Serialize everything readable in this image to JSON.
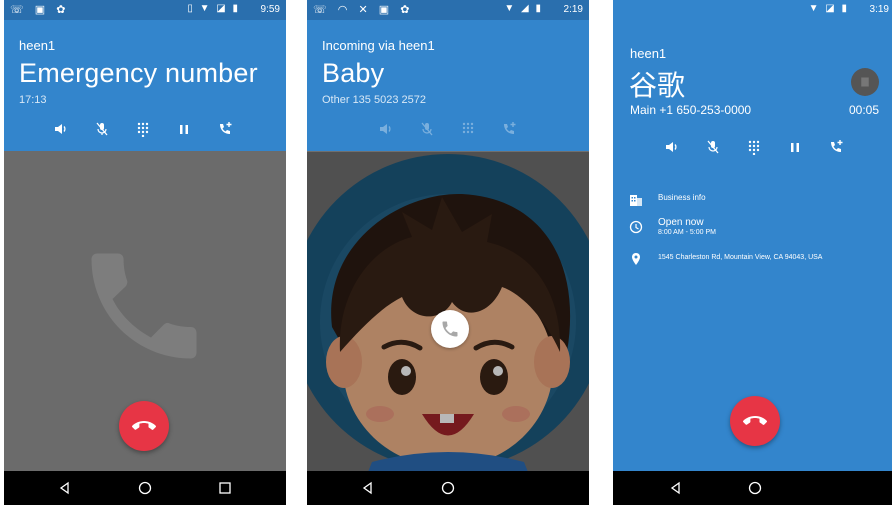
{
  "screen1": {
    "status_time": "9:59",
    "account": "heen1",
    "name": "Emergency number",
    "subtitle": "17:13",
    "controls": [
      "speaker-icon",
      "mute-icon",
      "dialpad-icon",
      "hold-icon",
      "add-call-icon"
    ]
  },
  "screen2": {
    "status_time": "2:19",
    "account": "Incoming via heen1",
    "name": "Baby",
    "subtitle": "Other 135 5023 2572"
  },
  "screen3": {
    "status_time": "3:19",
    "account": "heen1",
    "name": "谷歌",
    "subtitle": "Main +1 650-253-0000",
    "duration": "00:05",
    "info": [
      {
        "icon": "business-icon",
        "text": "Business info",
        "detail": ""
      },
      {
        "icon": "clock-icon",
        "text": "Open now",
        "detail": "8:00 AM - 5:00 PM"
      },
      {
        "icon": "location-pin-icon",
        "text": "1545 Charleston Rd, Mountain View, CA 94043, USA",
        "detail": ""
      }
    ]
  },
  "colors": {
    "primary": "#3385cc",
    "statusbar": "#2a6fae",
    "end_call": "#e73545"
  }
}
